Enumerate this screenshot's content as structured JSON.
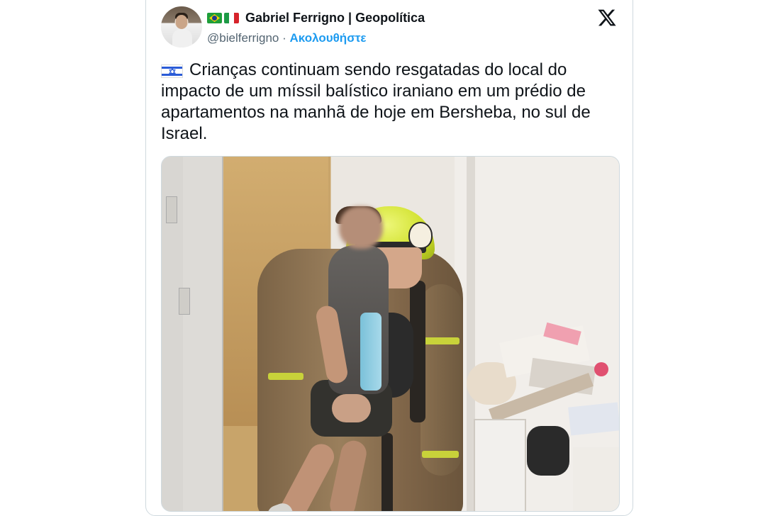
{
  "tweet": {
    "author": {
      "flags": [
        "brazil-flag-icon",
        "italy-flag-icon"
      ],
      "display_name": "Gabriel Ferrigno | Geopolítica",
      "handle": "@bielferrigno",
      "separator": "·",
      "follow_label": "Ακολουθήστε"
    },
    "platform_logo": "x-logo-icon",
    "text_flag": "israel-flag-icon",
    "text": "Crianças continuam sendo resgatadas do local do impacto de um míssil balístico iraniano em um prédio de apartamentos na manhã de hoje em Bersheba, no sul de Israel.",
    "media": {
      "type": "photo",
      "subject": "firefighter carrying child"
    }
  },
  "colors": {
    "text_primary": "#0f1419",
    "text_secondary": "#536471",
    "accent": "#1d9bf0",
    "border": "#cfd9de"
  }
}
